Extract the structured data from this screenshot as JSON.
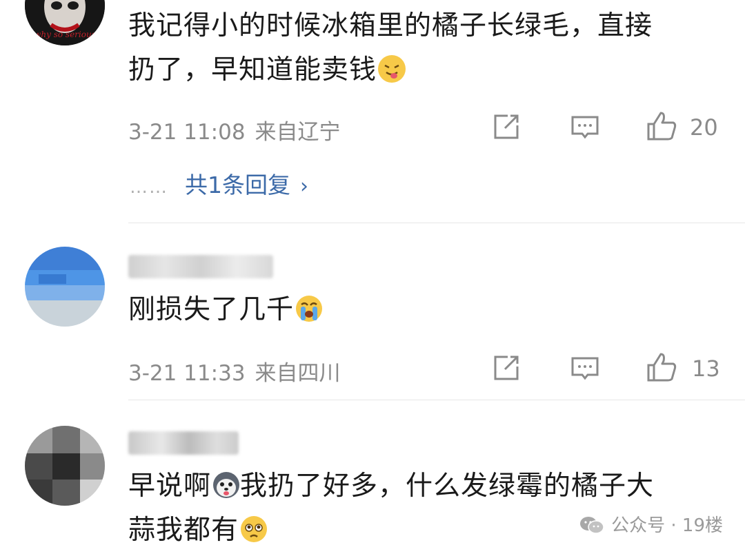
{
  "comments": [
    {
      "avatar_icon": "joker-avatar-icon",
      "text_line1": "我记得小的时候冰箱里的橘子长绿毛，直接",
      "text_line2": "扔了，早知道能卖钱",
      "emoji": "😝",
      "date": "3-21 11:08",
      "location": "来自辽宁",
      "likes": "20",
      "replies_label": "共1条回复",
      "replies_dots": "……"
    },
    {
      "avatar_icon": "blurred-avatar-icon",
      "text_line1": "刚损失了几千",
      "emoji": "😭",
      "date": "3-21 11:33",
      "location": "来自四川",
      "likes": "13"
    },
    {
      "avatar_icon": "blurred-avatar-icon",
      "text_line1_a": "早说啊",
      "text_line1_b": "我扔了好多，什么发绿霉的橘子大",
      "text_line2": "蒜我都有",
      "emoji_a": "🐶",
      "emoji_b": "🥺"
    }
  ],
  "watermark": {
    "text": "公众号 · 19楼",
    "icon": "wechat-icon"
  },
  "icons": {
    "share": "share-icon",
    "comment": "comment-icon",
    "like": "like-icon",
    "arrow": "chevron-right-icon"
  }
}
